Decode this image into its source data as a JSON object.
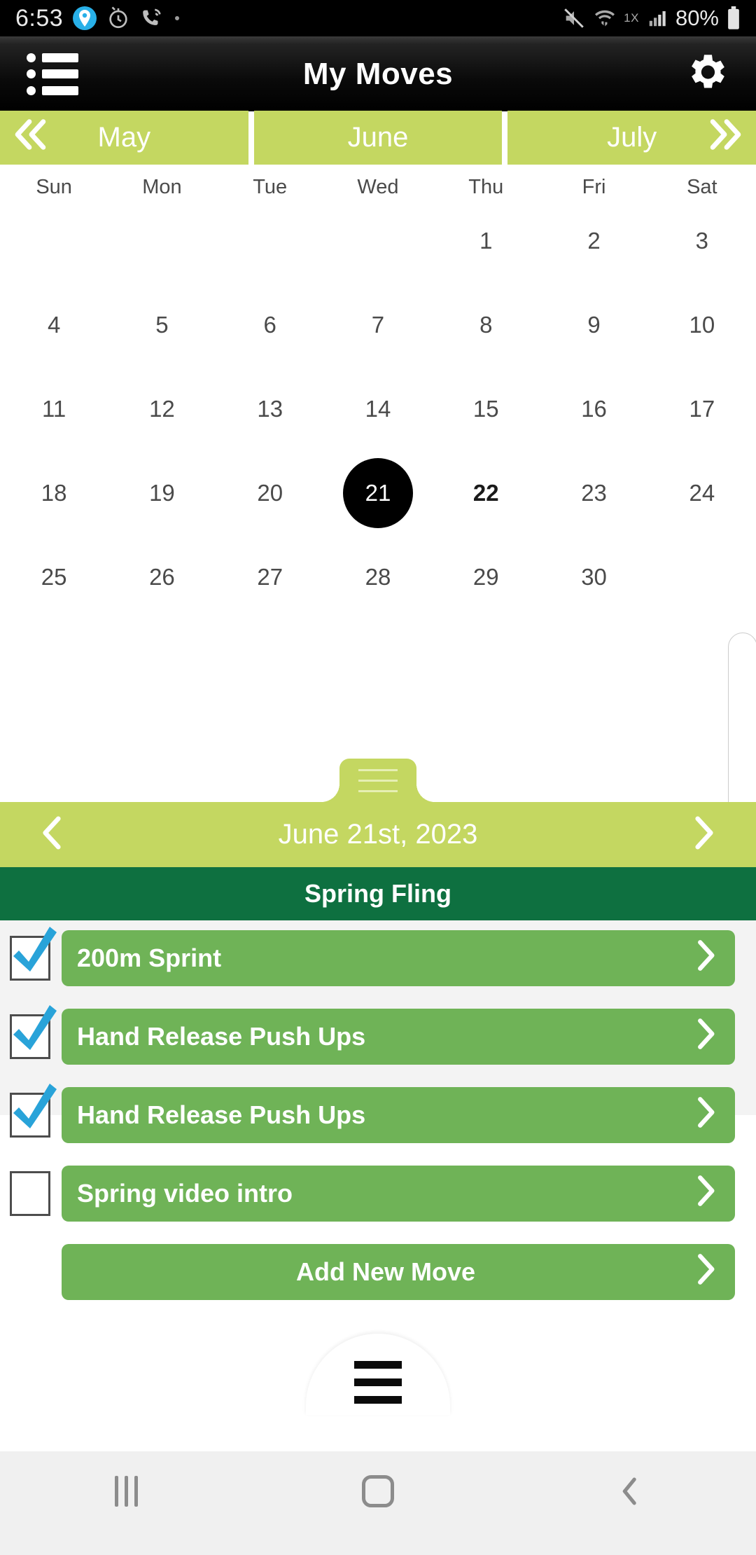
{
  "status_bar": {
    "time": "6:53",
    "network_type": "1X",
    "battery_percent": "80%",
    "icons": [
      "location-pin-icon",
      "alarm-icon",
      "missed-call-icon",
      "dot-icon",
      "mute-icon",
      "wifi-icon",
      "signal-bars-icon",
      "battery-icon"
    ]
  },
  "header": {
    "title": "My Moves",
    "menu_icon": "bulleted-list-icon",
    "settings_icon": "gear-icon"
  },
  "month_selector": {
    "prev_icon": "double-chevron-left-icon",
    "next_icon": "double-chevron-right-icon",
    "months": [
      {
        "label": "May",
        "selected": false
      },
      {
        "label": "June",
        "selected": true
      },
      {
        "label": "July",
        "selected": false
      }
    ]
  },
  "calendar": {
    "day_headers": [
      "Sun",
      "Mon",
      "Tue",
      "Wed",
      "Thu",
      "Fri",
      "Sat"
    ],
    "selected_day": 21,
    "weeks": [
      [
        "",
        "",
        "",
        "",
        "1",
        "2",
        "3"
      ],
      [
        "4",
        "5",
        "6",
        "7",
        "8",
        "9",
        "10"
      ],
      [
        "11",
        "12",
        "13",
        "14",
        "15",
        "16",
        "17"
      ],
      [
        "18",
        "19",
        "20",
        "21",
        "22",
        "23",
        "24"
      ],
      [
        "25",
        "26",
        "27",
        "28",
        "29",
        "30",
        ""
      ]
    ]
  },
  "date_nav": {
    "label": "June 21st, 2023",
    "prev_icon": "chevron-left-icon",
    "next_icon": "chevron-right-icon",
    "handle_icon": "drag-handle-icon"
  },
  "workout": {
    "title": "Spring Fling",
    "moves": [
      {
        "label": "200m Sprint",
        "checked": true
      },
      {
        "label": "Hand Release Push Ups",
        "checked": true
      },
      {
        "label": "Hand Release Push Ups",
        "checked": true
      },
      {
        "label": "Spring video intro",
        "checked": false
      }
    ],
    "add_button": {
      "label": "Add New Move"
    },
    "chevron_icon": "chevron-right-icon",
    "check_icon": "checkmark-icon"
  },
  "footer": {
    "fab_icon": "hamburger-menu-icon"
  },
  "android_nav": {
    "recents_icon": "recents-icon",
    "home_icon": "home-icon",
    "back_icon": "back-icon"
  },
  "colors": {
    "month_green": "#c4d761",
    "section_green": "#0e7040",
    "pill_green": "#6fb357",
    "check_blue": "#29a3d9",
    "list_bg": "#f3f3f3"
  }
}
